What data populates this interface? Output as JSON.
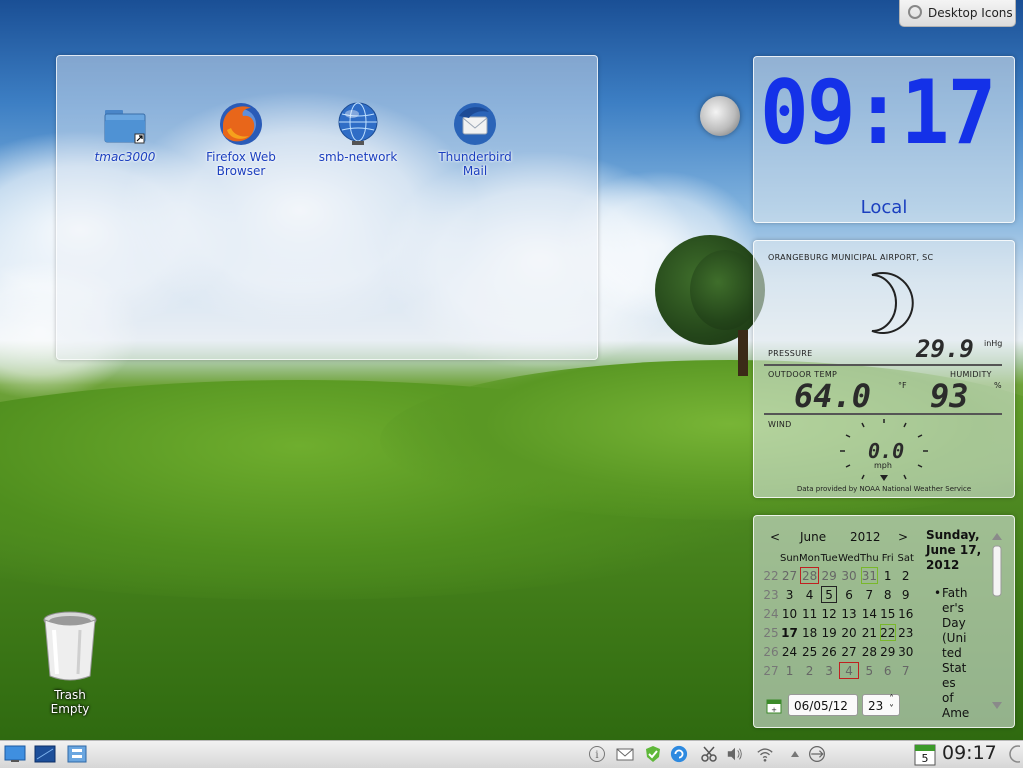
{
  "desktop": {
    "toolbox_label": "Desktop Icons"
  },
  "folder_view": {
    "icons": [
      {
        "label": "tmac3000",
        "icon": "folder-icon"
      },
      {
        "label": "Firefox Web Browser",
        "icon": "firefox-icon"
      },
      {
        "label": "smb-network",
        "icon": "network-globe-icon"
      },
      {
        "label": "Thunderbird Mail",
        "icon": "thunderbird-icon"
      }
    ]
  },
  "trash": {
    "label": "Trash",
    "status": "Empty",
    "icon": "trash-can-icon"
  },
  "clock_widget": {
    "time": "09:17",
    "timezone": "Local",
    "digit_color": "#1431e8"
  },
  "weather_widget": {
    "station": "ORANGEBURG MUNICIPAL AIRPORT, SC",
    "condition_icon": "crescent-moon-icon",
    "pressure_label": "PRESSURE",
    "pressure_value": "29.9",
    "pressure_unit": "inHg",
    "outdoor_temp_label": "OUTDOOR TEMP",
    "outdoor_temp_value": "64.0",
    "temp_unit": "°F",
    "humidity_label": "HUMIDITY",
    "humidity_value": "93",
    "humidity_unit": "%",
    "wind_label": "WIND",
    "wind_value": "0.0",
    "wind_unit": "mph",
    "credit": "Data provided by NOAA National Weather Service"
  },
  "calendar_widget": {
    "prev": "<",
    "next": ">",
    "month": "June",
    "year": "2012",
    "weekdays": [
      "Sun",
      "Mon",
      "Tue",
      "Wed",
      "Thu",
      "Fri",
      "Sat"
    ],
    "weeks": [
      {
        "week": "22",
        "days": [
          "27",
          "28",
          "29",
          "30",
          "31",
          "1",
          "2"
        ]
      },
      {
        "week": "23",
        "days": [
          "3",
          "4",
          "5",
          "6",
          "7",
          "8",
          "9"
        ]
      },
      {
        "week": "24",
        "days": [
          "10",
          "11",
          "12",
          "13",
          "14",
          "15",
          "16"
        ]
      },
      {
        "week": "25",
        "days": [
          "17",
          "18",
          "19",
          "20",
          "21",
          "22",
          "23"
        ]
      },
      {
        "week": "26",
        "days": [
          "24",
          "25",
          "26",
          "27",
          "28",
          "29",
          "30"
        ]
      },
      {
        "week": "27",
        "days": [
          "1",
          "2",
          "3",
          "4",
          "5",
          "6",
          "7"
        ]
      }
    ],
    "selected_date_line1": "Sunday,",
    "selected_date_line2": "June 17,",
    "selected_date_line3": "2012",
    "event_lines": [
      "Fath",
      "er's",
      "Day",
      "(Uni",
      "ted",
      "Stat",
      "es",
      "of",
      "Ame"
    ],
    "bullet": "•",
    "date_field": "06/05/12",
    "week_field": "23",
    "spin_icon": "spinbox-arrows-icon",
    "calendar_icon": "calendar-icon"
  },
  "taskbar": {
    "launchers": [
      "show-desktop-icon",
      "desktop-pager-icon",
      "file-manager-icon"
    ],
    "tray": [
      "info-icon",
      "mail-icon",
      "check-shield-icon",
      "updates-icon",
      "scissors-icon",
      "volume-icon",
      "wifi-icon",
      "tray-expand-icon",
      "network-manager-icon"
    ],
    "calendar_day": "5",
    "clock": "09:17"
  }
}
